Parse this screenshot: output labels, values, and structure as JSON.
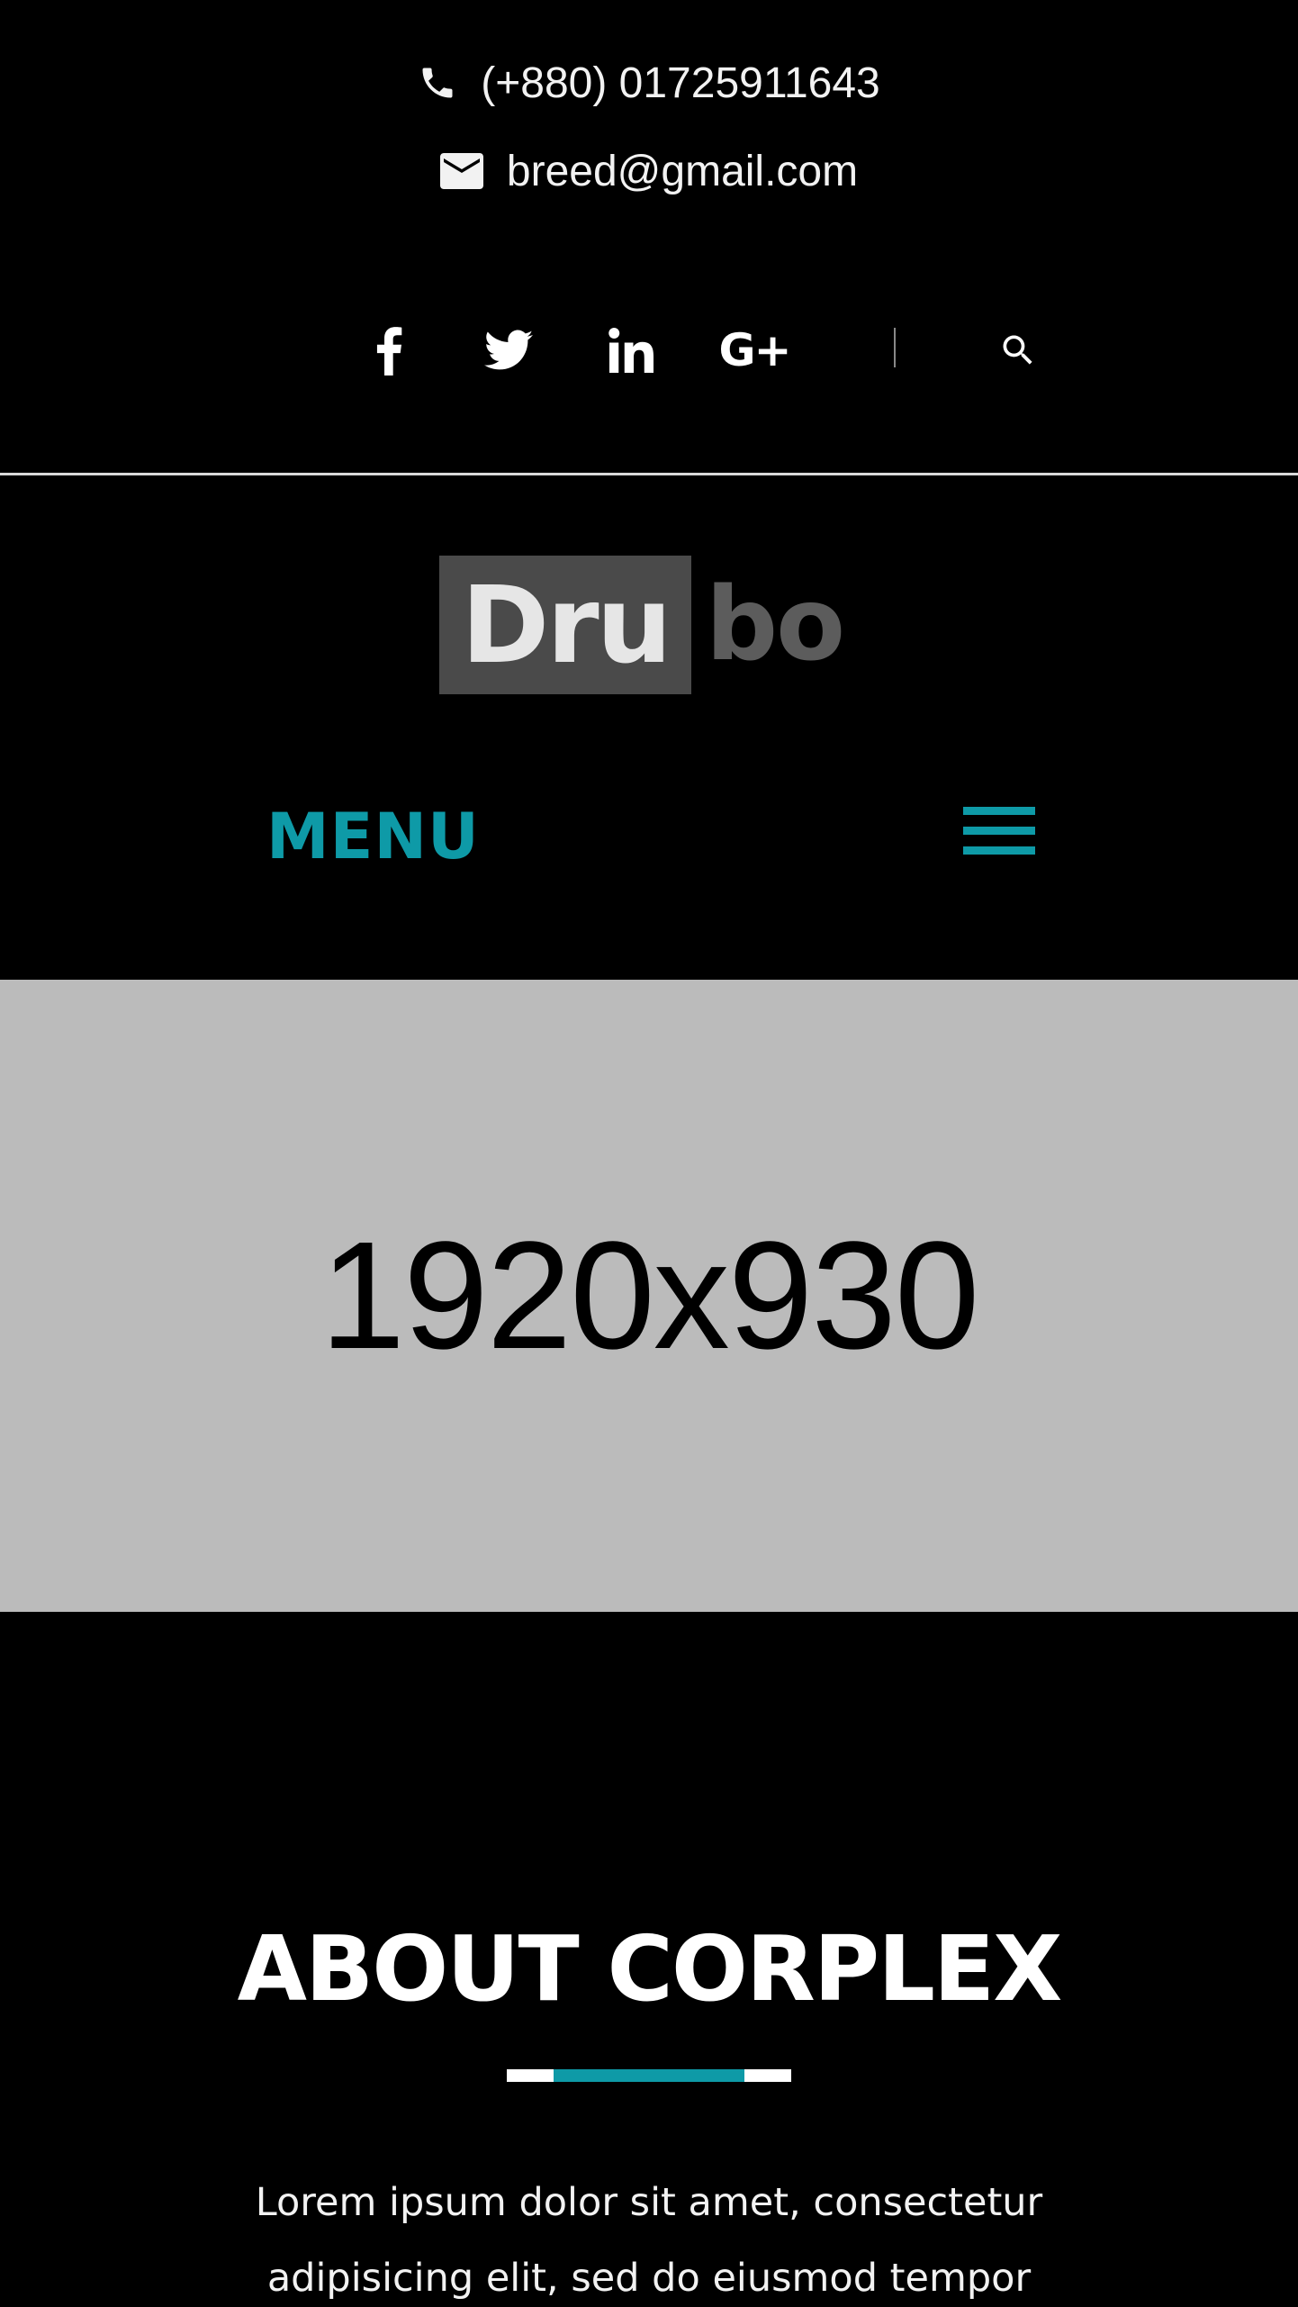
{
  "contact": {
    "phone": "(+880) 01725911643",
    "email": "breed@gmail.com"
  },
  "social": {
    "icons": [
      "facebook-icon",
      "twitter-icon",
      "linkedin-icon",
      "google-plus-icon",
      "search-icon"
    ],
    "gplus_text": "G+"
  },
  "logo": {
    "part1": "Dru",
    "part2": "bo"
  },
  "nav": {
    "menu_label": "MENU"
  },
  "hero": {
    "placeholder_text": "1920x930"
  },
  "about": {
    "title": "ABOUT CORPLEX",
    "line1": "Lorem ipsum dolor sit amet, consectetur",
    "line2": "adipisicing elit, sed do eiusmod tempor"
  },
  "colors": {
    "accent": "#0e9aa7",
    "background": "#000000",
    "hero_bg": "#bbbbbb"
  }
}
